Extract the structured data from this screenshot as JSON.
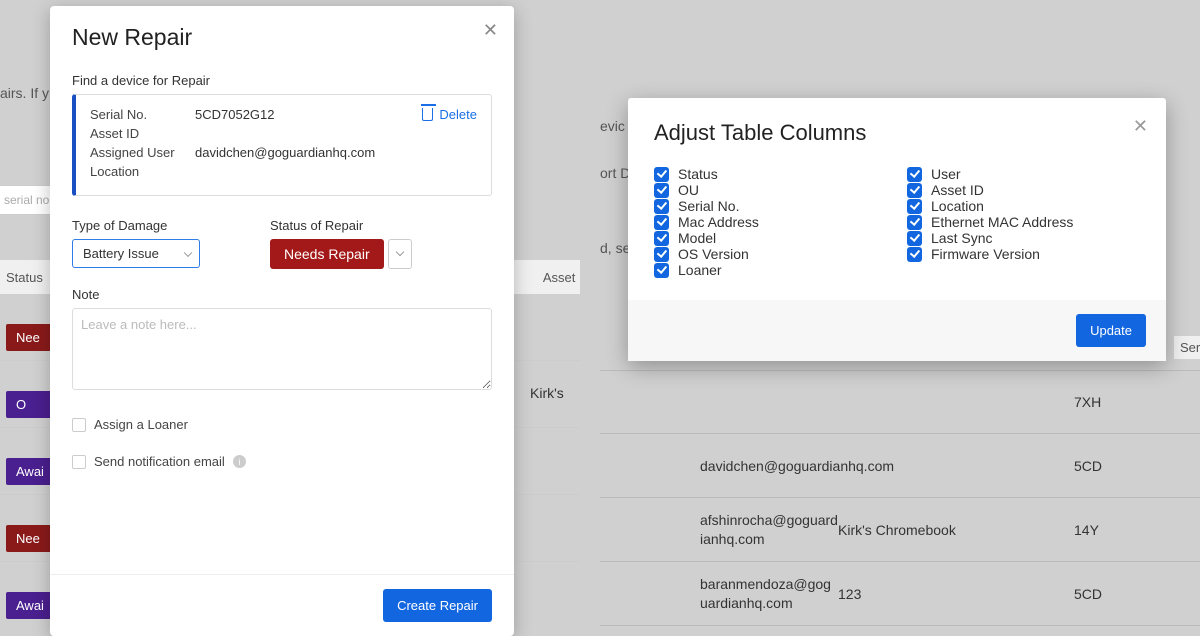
{
  "bg_left": {
    "text_fragment_1": "airs. If y",
    "input_placeholder": "serial no",
    "header_status": "Status",
    "header_asset": "Asset",
    "badges": [
      "Nee",
      "O",
      "Awai",
      "Nee",
      "Awai"
    ],
    "asset_cell": "Kirk's"
  },
  "bg_mid": {
    "text_evic": "evic",
    "text_ort": "ort D",
    "text_dse": "d, se"
  },
  "bg_right": {
    "header_seri": "Seri",
    "rows": [
      {
        "user": "",
        "asset": "",
        "serial": "7XH"
      },
      {
        "user": "davidchen@goguardianhq.com",
        "asset": "",
        "serial": "5CD"
      },
      {
        "user": "afshinrocha@goguardianhq.com",
        "asset": "Kirk's Chromebook",
        "serial": "14Y"
      },
      {
        "user": "baranmendoza@goguardianhq.com",
        "asset": "123",
        "serial": "5CD"
      }
    ]
  },
  "new_repair": {
    "title": "New Repair",
    "find_label": "Find a device for Repair",
    "card": {
      "serial_k": "Serial No.",
      "serial_v": "5CD7052G12",
      "asset_k": "Asset ID",
      "asset_v": "",
      "user_k": "Assigned User",
      "user_v": "davidchen@goguardianhq.com",
      "location_k": "Location",
      "location_v": ""
    },
    "delete_label": "Delete",
    "damage_label": "Type of Damage",
    "damage_value": "Battery Issue",
    "status_label": "Status of Repair",
    "status_value": "Needs Repair",
    "note_label": "Note",
    "note_placeholder": "Leave a note here...",
    "loaner_label": "Assign a Loaner",
    "email_label": "Send notification email",
    "create_btn": "Create Repair"
  },
  "adjust_cols": {
    "title": "Adjust Table Columns",
    "left": [
      "Status",
      "OU",
      "Serial No.",
      "Mac Address",
      "Model",
      "OS Version",
      "Loaner"
    ],
    "right": [
      "User",
      "Asset ID",
      "Location",
      "Ethernet MAC Address",
      "Last Sync",
      "Firmware Version"
    ],
    "update_btn": "Update"
  }
}
